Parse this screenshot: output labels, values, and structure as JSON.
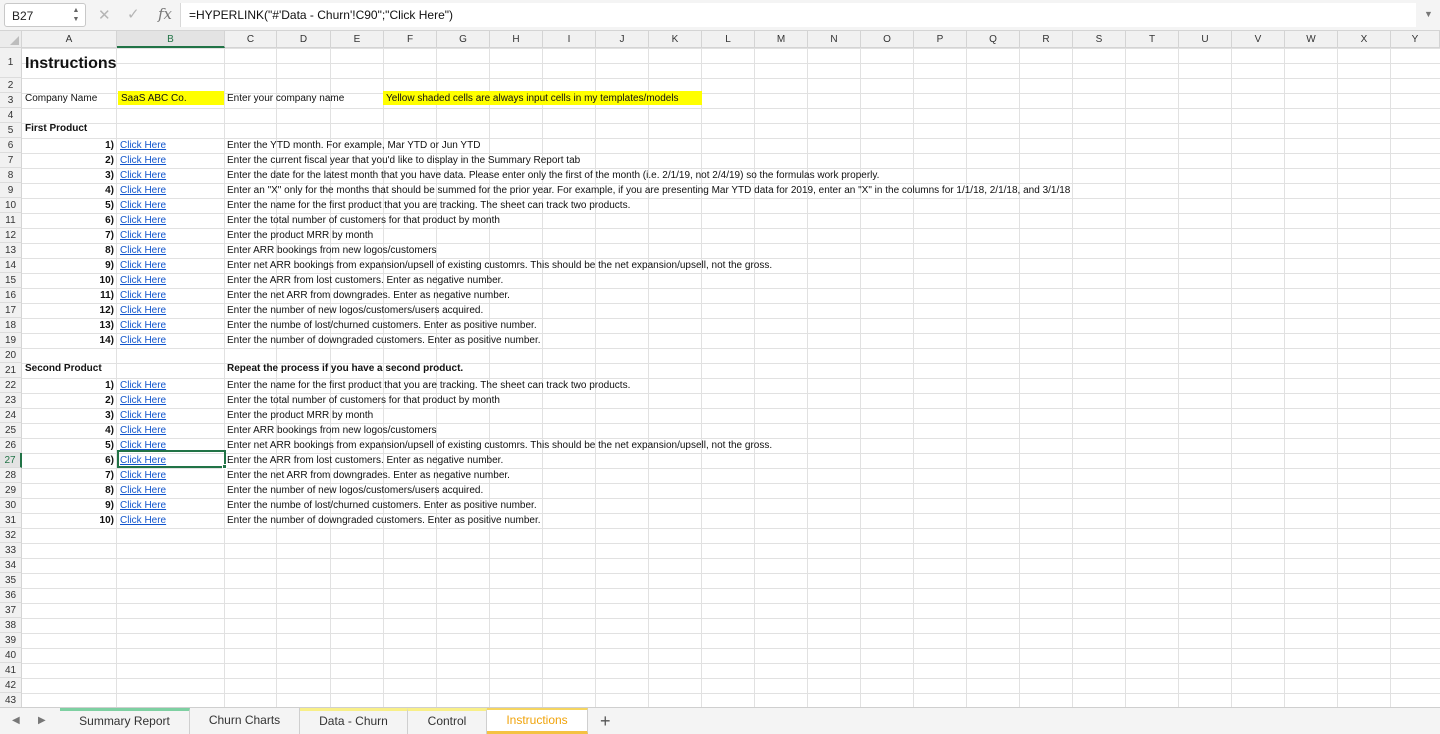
{
  "formula_bar": {
    "cell_ref": "B27",
    "fx": "fx",
    "cancel": "✕",
    "confirm": "✓",
    "formula": "=HYPERLINK(\"#'Data - Churn'!C90\";\"Click Here\")"
  },
  "columns": [
    "A",
    "B",
    "C",
    "D",
    "E",
    "F",
    "G",
    "H",
    "I",
    "J",
    "K",
    "L",
    "M",
    "N",
    "O",
    "P",
    "Q",
    "R",
    "S",
    "T",
    "U",
    "V",
    "W",
    "X",
    "Y"
  ],
  "rows": [
    "1",
    "2",
    "3",
    "4",
    "5",
    "6",
    "7",
    "8",
    "9",
    "10",
    "11",
    "12",
    "13",
    "14",
    "15",
    "16",
    "17",
    "18",
    "19",
    "20",
    "21",
    "22",
    "23",
    "24",
    "25",
    "26",
    "27",
    "28",
    "29",
    "30",
    "31",
    "32",
    "33",
    "34",
    "35",
    "36",
    "37",
    "38",
    "39",
    "40",
    "41",
    "42",
    "43"
  ],
  "sheet": {
    "title": "Instructions",
    "company_label": "Company Name",
    "company_value": "SaaS ABC Co.",
    "company_hint": "Enter your company name",
    "yellow_note": "Yellow shaded cells are always input cells in my templates/models",
    "first_product_label": "First Product",
    "first_steps": [
      {
        "num": "1)",
        "link": "Click Here",
        "desc": "Enter the YTD month.  For example, Mar YTD or Jun YTD"
      },
      {
        "num": "2)",
        "link": "Click Here",
        "desc": "Enter the current fiscal year that you'd like to display in the Summary Report tab"
      },
      {
        "num": "3)",
        "link": "Click Here",
        "desc": "Enter the date for the latest month that you have data.  Please enter only the first of the month (i.e. 2/1/19, not 2/4/19) so the formulas work properly."
      },
      {
        "num": "4)",
        "link": "Click Here",
        "desc": "Enter an \"X\" only for the months that should be summed for the prior year.  For example, if you are presenting Mar YTD data for 2019, enter an \"X\" in the columns for 1/1/18, 2/1/18, and 3/1/18"
      },
      {
        "num": "5)",
        "link": "Click Here",
        "desc": "Enter the name for the first product that you are tracking.  The sheet can track two products."
      },
      {
        "num": "6)",
        "link": "Click Here",
        "desc": "Enter the total number of customers for that product by month"
      },
      {
        "num": "7)",
        "link": "Click Here",
        "desc": "Enter the product MRR by month"
      },
      {
        "num": "8)",
        "link": "Click Here",
        "desc": "Enter ARR bookings from new logos/customers"
      },
      {
        "num": "9)",
        "link": "Click Here",
        "desc": "Enter net ARR bookings from expansion/upsell of existing customrs.  This should be the net expansion/upsell, not the gross."
      },
      {
        "num": "10)",
        "link": "Click Here",
        "desc": "Enter the ARR from lost customers.  Enter as negative number."
      },
      {
        "num": "11)",
        "link": "Click Here",
        "desc": "Enter the net ARR from downgrades.  Enter as negative number."
      },
      {
        "num": "12)",
        "link": "Click Here",
        "desc": "Enter the number of new logos/customers/users acquired."
      },
      {
        "num": "13)",
        "link": "Click Here",
        "desc": "Enter the numbe of lost/churned customers.  Enter as positive number."
      },
      {
        "num": "14)",
        "link": "Click Here",
        "desc": "Enter the number of downgraded customers.  Enter as positive number."
      }
    ],
    "second_product_label": "Second Product",
    "second_intro": "Repeat the process if you have a second product.",
    "second_steps": [
      {
        "num": "1)",
        "link": "Click Here",
        "desc": "Enter the name for the first product that you are tracking.  The sheet can track two products."
      },
      {
        "num": "2)",
        "link": "Click Here",
        "desc": "Enter the total number of customers for that product by month"
      },
      {
        "num": "3)",
        "link": "Click Here",
        "desc": "Enter the product MRR by month"
      },
      {
        "num": "4)",
        "link": "Click Here",
        "desc": "Enter ARR bookings from new logos/customers"
      },
      {
        "num": "5)",
        "link": "Click Here",
        "desc": "Enter net ARR bookings from expansion/upsell of existing customrs.  This should be the net expansion/upsell, not the gross."
      },
      {
        "num": "6)",
        "link": "Click Here",
        "desc": "Enter the ARR from lost customers.  Enter as negative number."
      },
      {
        "num": "7)",
        "link": "Click Here",
        "desc": "Enter the net ARR from downgrades.  Enter as negative number."
      },
      {
        "num": "8)",
        "link": "Click Here",
        "desc": "Enter the number of new logos/customers/users acquired."
      },
      {
        "num": "9)",
        "link": "Click Here",
        "desc": "Enter the numbe of lost/churned customers.  Enter as positive number."
      },
      {
        "num": "10)",
        "link": "Click Here",
        "desc": "Enter the number of downgraded customers.  Enter as positive number."
      }
    ]
  },
  "tabs": [
    {
      "label": "Summary Report",
      "style": "green"
    },
    {
      "label": "Churn Charts",
      "style": "plain"
    },
    {
      "label": "Data - Churn",
      "style": "yellow"
    },
    {
      "label": "Control",
      "style": "yellow"
    },
    {
      "label": "Instructions",
      "style": "active"
    }
  ],
  "add_tab_label": "+",
  "colors": {
    "accent": "#217346",
    "input_fill": "#ffff00",
    "link": "#1155cc",
    "active_tab": "#f0a30a"
  }
}
